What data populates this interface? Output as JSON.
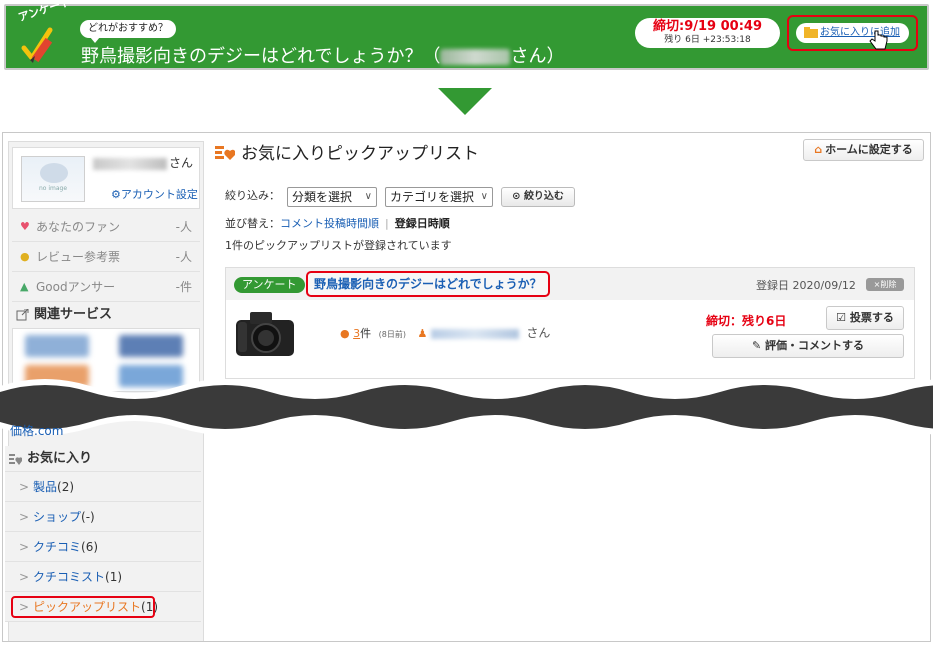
{
  "banner": {
    "corner_tag": "アンケート",
    "bubble": "どれがおすすめ？",
    "title_main": "野鳥撮影向きのデジーはどれでしょうか？（",
    "title_suffix": "さん）",
    "deadline_main": "締切:9/19 00:49",
    "deadline_sub": "残り 6日 +23:53:18",
    "fav_add_label": "お気に入りに追加"
  },
  "sidebar": {
    "profile": {
      "name_suffix": "さん",
      "avatar_text": "no image",
      "account_settings": "アカウント設定"
    },
    "stats": [
      {
        "label": "あなたのファン",
        "value": "-人",
        "icon": "fan-icon"
      },
      {
        "label": "レビュー参考票",
        "value": "-人",
        "icon": "medal-icon"
      },
      {
        "label": "Goodアンサー",
        "value": "-件",
        "icon": "hand-icon"
      }
    ],
    "related_heading": "関連サービス",
    "partial_link": "価格.com",
    "favorites_heading": "お気に入り",
    "favorites": [
      {
        "label": "製品",
        "count": "(2)"
      },
      {
        "label": "ショップ",
        "count": "(-)"
      },
      {
        "label": "クチコミ",
        "count": "(6)"
      },
      {
        "label": "クチコミスト",
        "count": "(1)"
      },
      {
        "label": "ピックアップリスト",
        "count": "(1)"
      }
    ]
  },
  "main": {
    "page_title": "お気に入りピックアップリスト",
    "home_button": "ホームに設定する",
    "filter_label": "絞り込み：",
    "filter_select_1": "分類を選択",
    "filter_select_2": "カテゴリを選択",
    "filter_button": "絞り込む",
    "sort_label": "並び替え：",
    "sort_option_1": "コメント投稿時間順",
    "sort_option_2": "登録日時順",
    "count_text": "1件のピックアップリストが登録されています",
    "item": {
      "tag": "アンケート",
      "title": "野鳥撮影向きのデジーはどれでしょうか？",
      "registered": "登録日 2020/09/12",
      "delete": "×削除",
      "comments": "3",
      "comments_suffix": "件",
      "ago": "(8日前)",
      "user_suffix": "さん",
      "deadline": "締切：残り6日",
      "vote_button": "投票する",
      "rate_button": "評価・コメントする"
    }
  },
  "colors": {
    "green": "#339933",
    "red": "#e60012",
    "link": "#1a5fb4",
    "orange": "#e87722"
  }
}
